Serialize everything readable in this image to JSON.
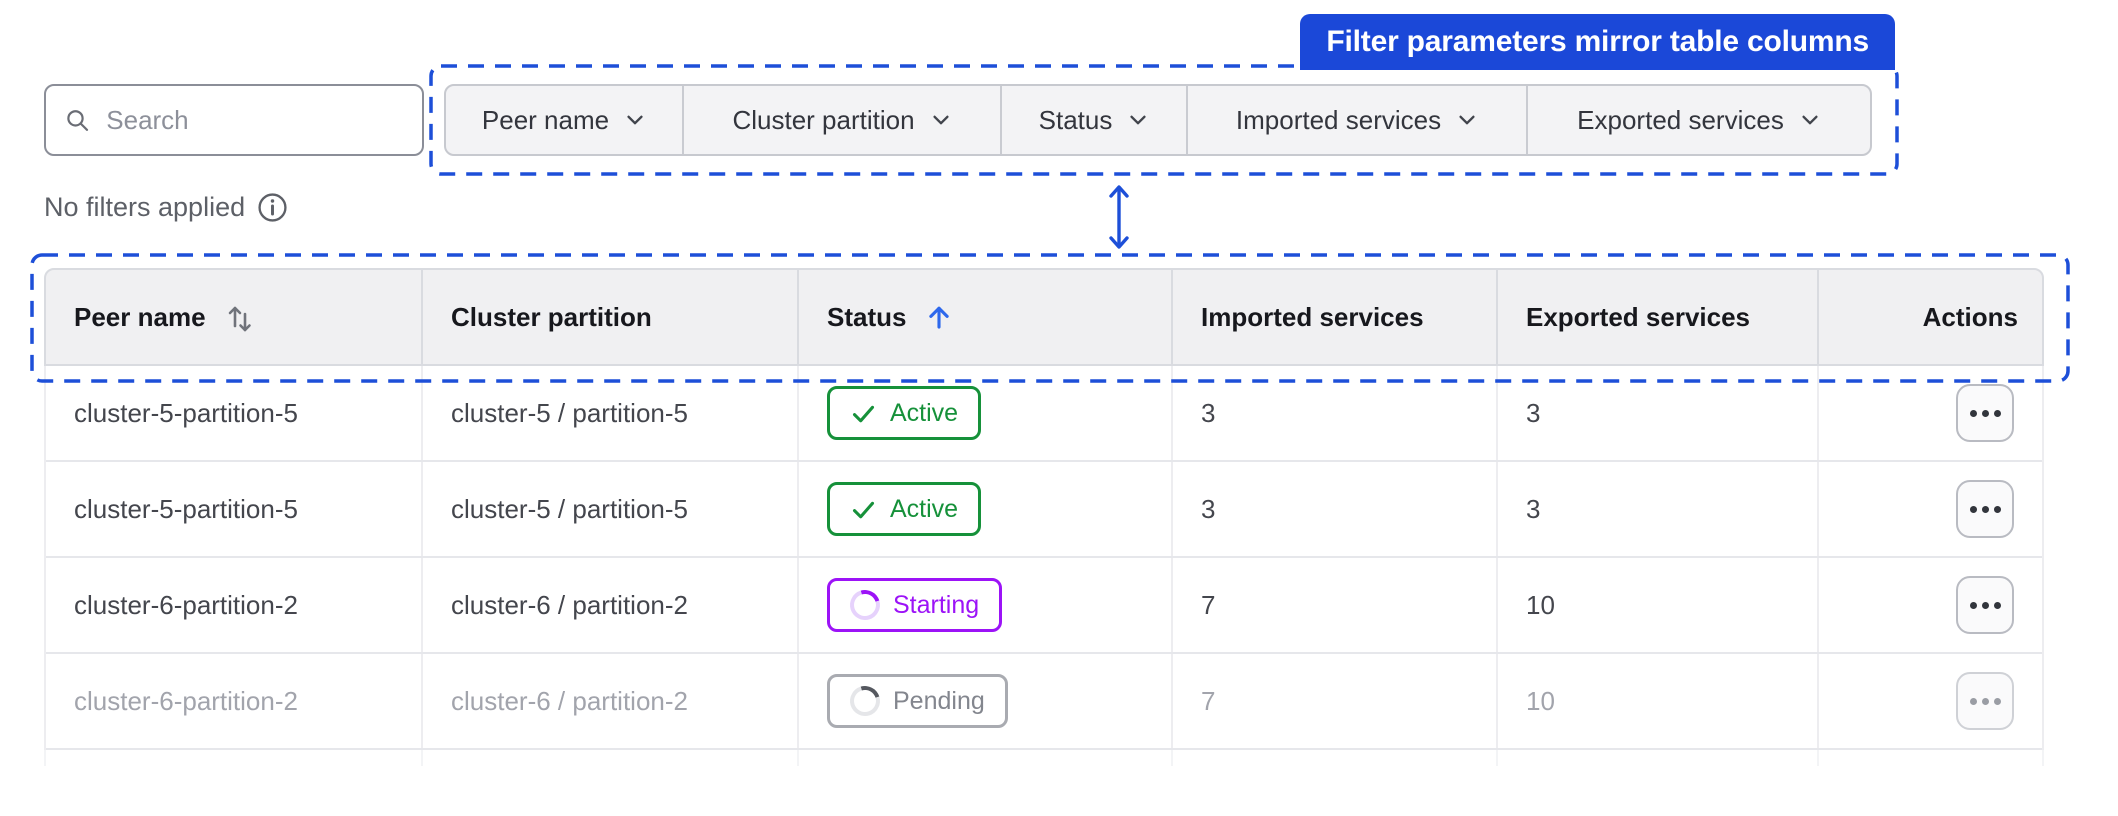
{
  "annotation": {
    "callout_label": "Filter parameters mirror table columns"
  },
  "toolbar": {
    "search": {
      "placeholder": "Search"
    },
    "filters": [
      {
        "label": "Peer name"
      },
      {
        "label": "Cluster partition"
      },
      {
        "label": "Status"
      },
      {
        "label": "Imported services"
      },
      {
        "label": "Exported services"
      }
    ],
    "filters_status_text": "No filters applied"
  },
  "table": {
    "columns": [
      {
        "label": "Peer name",
        "sort": "sortable"
      },
      {
        "label": "Cluster partition"
      },
      {
        "label": "Status",
        "sort": "ascending"
      },
      {
        "label": "Imported services"
      },
      {
        "label": "Exported services"
      },
      {
        "label": "Actions"
      }
    ],
    "rows": [
      {
        "peer_name": "cluster-5-partition-5",
        "cluster_partition": "cluster-5 / partition-5",
        "status": "Active",
        "imported": "3",
        "exported": "3",
        "dimmed": false
      },
      {
        "peer_name": "cluster-5-partition-5",
        "cluster_partition": "cluster-5 / partition-5",
        "status": "Active",
        "imported": "3",
        "exported": "3",
        "dimmed": false
      },
      {
        "peer_name": "cluster-6-partition-2",
        "cluster_partition": "cluster-6 / partition-2",
        "status": "Starting",
        "imported": "7",
        "exported": "10",
        "dimmed": false
      },
      {
        "peer_name": "cluster-6-partition-2",
        "cluster_partition": "cluster-6 / partition-2",
        "status": "Pending",
        "imported": "7",
        "exported": "10",
        "dimmed": true
      }
    ]
  },
  "colors": {
    "annotation_blue": "#1d4fd8",
    "callout_bg": "#1b48d8",
    "active_green": "#16913a",
    "starting_purple": "#9c13f7",
    "pending_gray": "#83868e",
    "header_bg": "#f0f0f2",
    "filter_bg": "#f3f3f5"
  }
}
